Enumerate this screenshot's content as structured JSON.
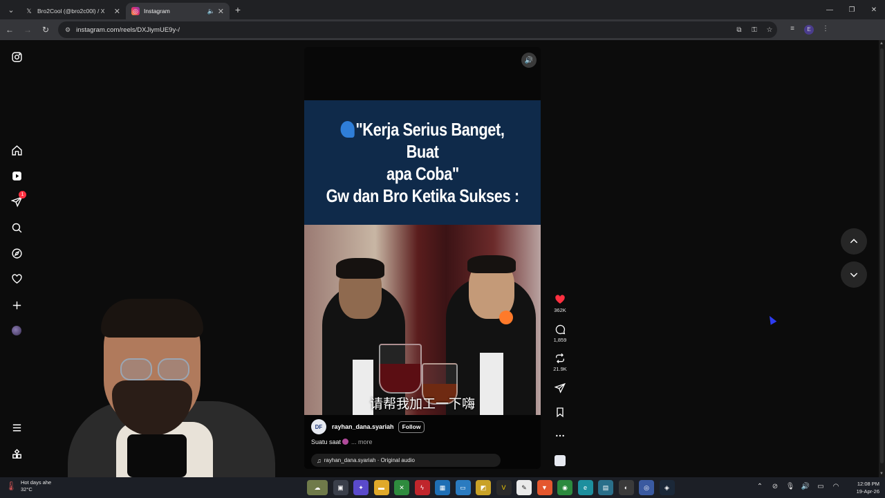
{
  "browser": {
    "tabs": [
      {
        "title": "Bro2Cool (@bro2c00l) / X",
        "favicon": "x-logo-icon",
        "active": false
      },
      {
        "title": "Instagram",
        "favicon": "instagram-icon",
        "active": true
      }
    ],
    "url": "instagram.com/reels/DXJiymUE9y-/",
    "profile_initial": "E"
  },
  "sidebar": {
    "notification_count": "1"
  },
  "reel": {
    "caption_lines": [
      "\"Kerja Serius Banget, Buat",
      "apa Coba\"",
      "Gw dan Bro Ketika Sukses :"
    ],
    "subtitle": "请帮我加工一下嗨",
    "author": {
      "avatar_text": "DF",
      "username": "rayhan_dana.syariah",
      "follow_label": "Follow"
    },
    "caption_text": "Suatu saat",
    "more_label": "... more",
    "audio": "rayhan_dana.syariah · Original audio"
  },
  "actions": {
    "likes": "362K",
    "comments": "1,859",
    "reposts": "21.9K"
  },
  "colors": {
    "like_red": "#ff3040",
    "caption_banner": "#0f2a4a",
    "cursor": "#2d3cf2"
  },
  "taskbar": {
    "weather_title": "Hot days ahe",
    "weather_temp": "32°C",
    "time": "12:08 PM",
    "date": "19-Apr-26"
  }
}
